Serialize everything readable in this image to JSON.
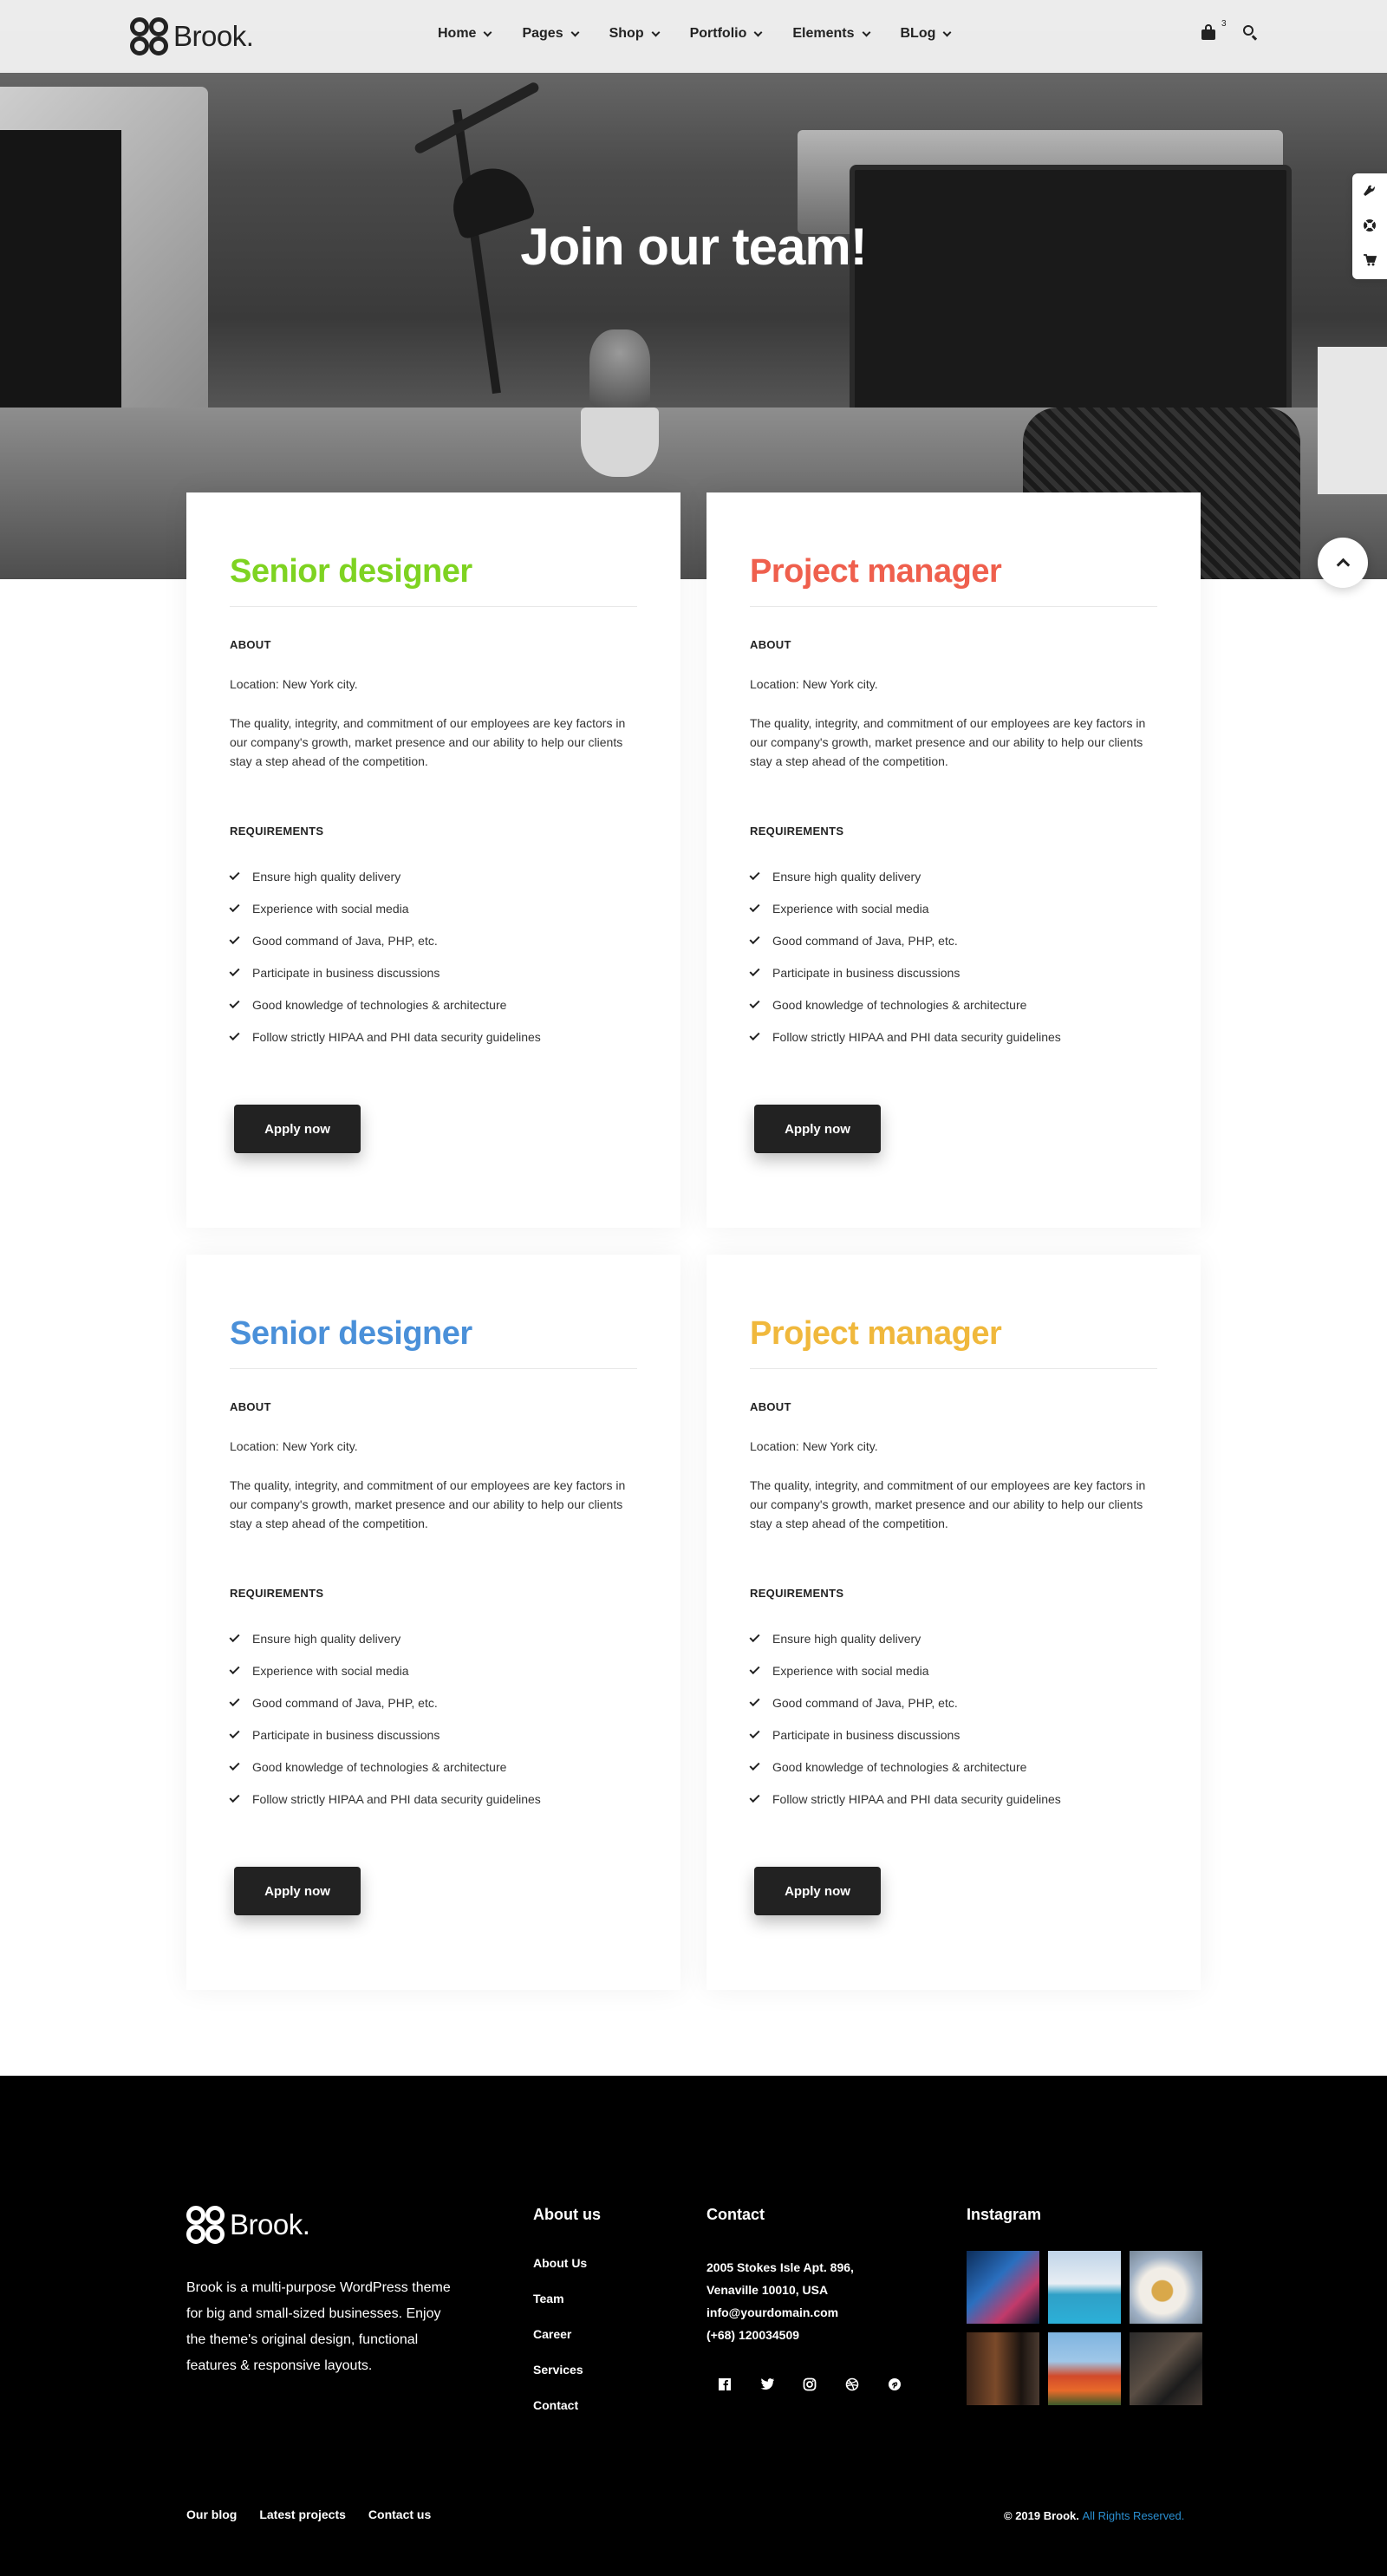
{
  "brand": {
    "name": "Brook."
  },
  "nav": {
    "items": [
      {
        "label": "Home"
      },
      {
        "label": "Pages"
      },
      {
        "label": "Shop"
      },
      {
        "label": "Portfolio"
      },
      {
        "label": "Elements"
      },
      {
        "label": "BLog"
      }
    ],
    "cart_count": "3",
    "icons": [
      "bag-icon",
      "search-icon"
    ]
  },
  "hero": {
    "title": "Join our team!"
  },
  "side_tools": {
    "icons": [
      "wrench-icon",
      "support-icon",
      "cart-icon"
    ]
  },
  "jobs": [
    {
      "title": "Senior designer",
      "color": "#7ed321",
      "about_heading": "ABOUT",
      "location": "Location: New York city.",
      "description": "The quality, integrity, and commitment of our employees are key factors in our company's growth, market presence and our ability to help our clients stay a step ahead of the competition.",
      "requirements_heading": "REQUIREMENTS",
      "requirements": [
        "Ensure high quality delivery",
        "Experience with social media",
        "Good command of Java, PHP, etc.",
        "Participate in business discussions",
        "Good knowledge of technologies & architecture",
        "Follow strictly HIPAA and PHI data security guidelines"
      ],
      "button": "Apply now"
    },
    {
      "title": "Project manager",
      "color": "#ef5f4d",
      "about_heading": "ABOUT",
      "location": "Location: New York city.",
      "description": "The quality, integrity, and commitment of our employees are key factors in our company's growth, market presence and our ability to help our clients stay a step ahead of the competition.",
      "requirements_heading": "REQUIREMENTS",
      "requirements": [
        "Ensure high quality delivery",
        "Experience with social media",
        "Good command of Java, PHP, etc.",
        "Participate in business discussions",
        "Good knowledge of technologies & architecture",
        "Follow strictly HIPAA and PHI data security guidelines"
      ],
      "button": "Apply now"
    },
    {
      "title": "Senior designer",
      "color": "#4a90d9",
      "about_heading": "ABOUT",
      "location": "Location: New York city.",
      "description": "The quality, integrity, and commitment of our employees are key factors in our company's growth, market presence and our ability to help our clients stay a step ahead of the competition.",
      "requirements_heading": "REQUIREMENTS",
      "requirements": [
        "Ensure high quality delivery",
        "Experience with social media",
        "Good command of Java, PHP, etc.",
        "Participate in business discussions",
        "Good knowledge of technologies & architecture",
        "Follow strictly HIPAA and PHI data security guidelines"
      ],
      "button": "Apply now"
    },
    {
      "title": "Project manager",
      "color": "#f0b83c",
      "about_heading": "ABOUT",
      "location": "Location: New York city.",
      "description": "The quality, integrity, and commitment of our employees are key factors in our company's growth, market presence and our ability to help our clients stay a step ahead of the competition.",
      "requirements_heading": "REQUIREMENTS",
      "requirements": [
        "Ensure high quality delivery",
        "Experience with social media",
        "Good command of Java, PHP, etc.",
        "Participate in business discussions",
        "Good knowledge of technologies & architecture",
        "Follow strictly HIPAA and PHI data security guidelines"
      ],
      "button": "Apply now"
    }
  ],
  "footer": {
    "brand": "Brook.",
    "about_text": "Brook is a multi-purpose WordPress theme for big and small-sized businesses. Enjoy the theme's original design, functional features & responsive layouts.",
    "about_title": "About us",
    "about_links": [
      "About Us",
      "Team",
      "Career",
      "Services",
      "Contact"
    ],
    "contact_title": "Contact",
    "address_line1": "2005 Stokes Isle Apt. 896,",
    "address_line2": "Venaville 10010, USA",
    "email": "info@yourdomain.com",
    "phone": "(+68) 120034509",
    "social_icons": [
      "facebook-icon",
      "twitter-icon",
      "instagram-icon",
      "dribbble-icon",
      "pinterest-icon"
    ],
    "instagram_title": "Instagram",
    "bottom_links": [
      "Our blog",
      "Latest projects",
      "Contact us"
    ],
    "copyright": "© 2019 Brook.",
    "rights": "All Rights Reserved."
  }
}
